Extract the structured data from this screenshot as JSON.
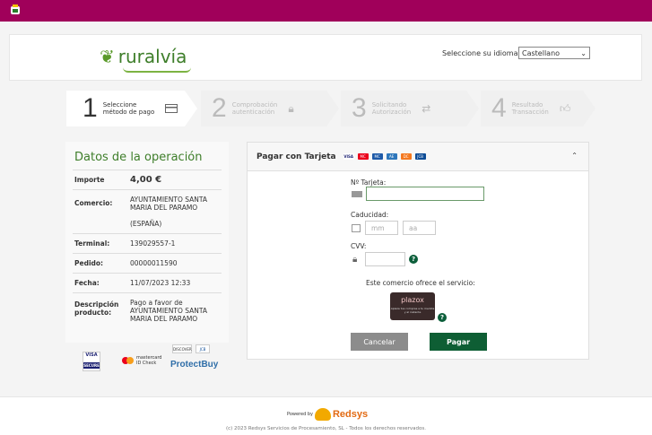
{
  "header": {
    "logo_text": "ruralvía",
    "language_label": "Seleccione su idioma",
    "language_selected": "Castellano"
  },
  "steps": [
    {
      "num": "1",
      "line1": "Seleccione",
      "line2": "método de pago"
    },
    {
      "num": "2",
      "line1": "Comprobación",
      "line2": "autenticación"
    },
    {
      "num": "3",
      "line1": "Solicitando",
      "line2": "Autorización"
    },
    {
      "num": "4",
      "line1": "Resultado",
      "line2": "Transacción"
    }
  ],
  "operation": {
    "title": "Datos de la operación",
    "rows": [
      {
        "label": "Importe",
        "value": "4,00 €"
      },
      {
        "label": "Comercio:",
        "value": "AYUNTAMIENTO SANTA MARIA DEL PARAMO",
        "value2": "(ESPAÑA)"
      },
      {
        "label": "Terminal:",
        "value": "139029557-1"
      },
      {
        "label": "Pedido:",
        "value": "00000011590"
      },
      {
        "label": "Fecha:",
        "value": "11/07/2023  12:33"
      },
      {
        "label": "Descripción producto:",
        "value": "Pago a favor de AYUNTAMIENTO SANTA MARIA DEL PARAMO"
      }
    ]
  },
  "badges": {
    "visa": "VISA",
    "visa_sub": "SECURE",
    "mastercard": "mastercard",
    "mastercard_sub": "ID Check",
    "discover": "DISCOVER",
    "jcb": "JCB",
    "protectbuy": "ProtectBuy"
  },
  "payment": {
    "title": "Pagar con Tarjeta",
    "brands": [
      "VISA",
      "MC",
      "MC",
      "AE",
      "DC",
      "JCB"
    ],
    "card_label": "Nº Tarjeta:",
    "card_value": "",
    "expiry_label": "Caducidad:",
    "mm_placeholder": "mm",
    "aa_placeholder": "aa",
    "cvv_label": "CVV:",
    "service_text": "Este comercio ofrece el servicio:",
    "plazox_name": "plazox",
    "plazox_tagline": "Aplaza tus compras a tu medida y al instante",
    "cancel_label": "Cancelar",
    "pay_label": "Pagar",
    "help_glyph": "?"
  },
  "footer": {
    "powered_by": "Powered by",
    "brand": "Redsys",
    "copyright": "(c) 2023 Redsys Servicios de Procesamiento, SL - Todos los derechos reservados."
  }
}
